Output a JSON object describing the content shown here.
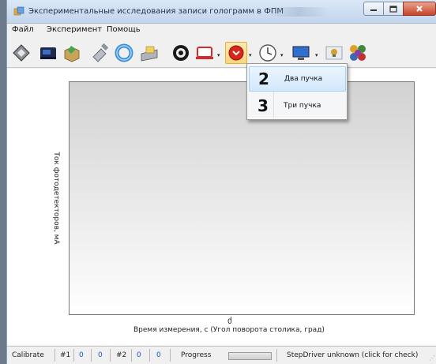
{
  "window": {
    "title": "Экспериментальные исследования записи голограмм в ФПМ"
  },
  "menu": [
    "Файл",
    "Эксперимент",
    "Помощь"
  ],
  "toolbar": {
    "buttons": [
      "connect-icon",
      "camera-icon",
      "package-icon",
      "satellite-icon",
      "ring-icon",
      "scanner-icon",
      "gear-icon",
      "laptop-icon",
      "record-icon",
      "clock-icon",
      "monitor-icon",
      "lightbulb-icon",
      "molecule-icon"
    ],
    "colors": {
      "active": "#f9d77d",
      "record": "#d9261c"
    }
  },
  "dropdown": {
    "items": [
      {
        "number": "2",
        "label": "Два пучка"
      },
      {
        "number": "3",
        "label": "Три пучка"
      }
    ]
  },
  "chart_data": {
    "type": "line",
    "series": [],
    "x_tick_labels": [
      "0"
    ],
    "xlabel": "Время измерения, с (Угол поворота столика, град)",
    "ylabel": "Ток фотодетекторов, мА",
    "grid": false
  },
  "status": {
    "calibrate": "Calibrate",
    "ch1_label": "#1",
    "ch1_a": "0",
    "ch1_b": "0",
    "ch2_label": "#2",
    "ch2_a": "0",
    "ch2_b": "0",
    "progress_label": "Progress",
    "driver": "StepDriver unknown (click for check)"
  }
}
